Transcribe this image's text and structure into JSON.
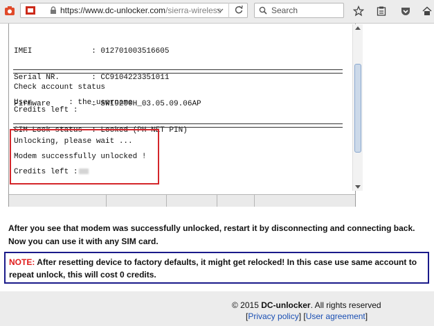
{
  "browser": {
    "url_host": "https://www.dc-unlocker.com",
    "url_path": "/sierra-wireless",
    "search_placeholder": "Search"
  },
  "terminal": {
    "lines": [
      "IMEI             : 012701003516605",
      "Serial NR.       : CC9104223351011",
      "Firmware         : SWI9200H_03.05.09.06AP",
      "SIM Lock status  : Locked (PH-NET PIN)"
    ],
    "check_account": "Check account status",
    "user_line": "User        : the_username",
    "credits_line": "Credits left :",
    "unlocking": "Unlocking, please wait ...",
    "success": "Modem successfully unlocked !",
    "credits_left_label": "Credits left :"
  },
  "instructions": {
    "paragraph": "After you see that modem was successfully unlocked, restart it by disconnecting and connecting back. Now you can use it with any SIM card."
  },
  "note": {
    "label": "NOTE:",
    "text": " After resetting device to factory defaults, it might get relocked! In this case use same account to repeat unlock, this will cost 0 credits."
  },
  "footer": {
    "copyright_prefix": "© 2015 ",
    "brand": "DC-unlocker",
    "copyright_suffix": ". All rights reserved",
    "privacy": "Privacy policy",
    "agreement": "User agreement"
  },
  "colors": {
    "highlight_box": "#d4252a",
    "note_border": "#1a1a8a",
    "note_label": "#e01b1b",
    "link": "#1a4fb3"
  }
}
